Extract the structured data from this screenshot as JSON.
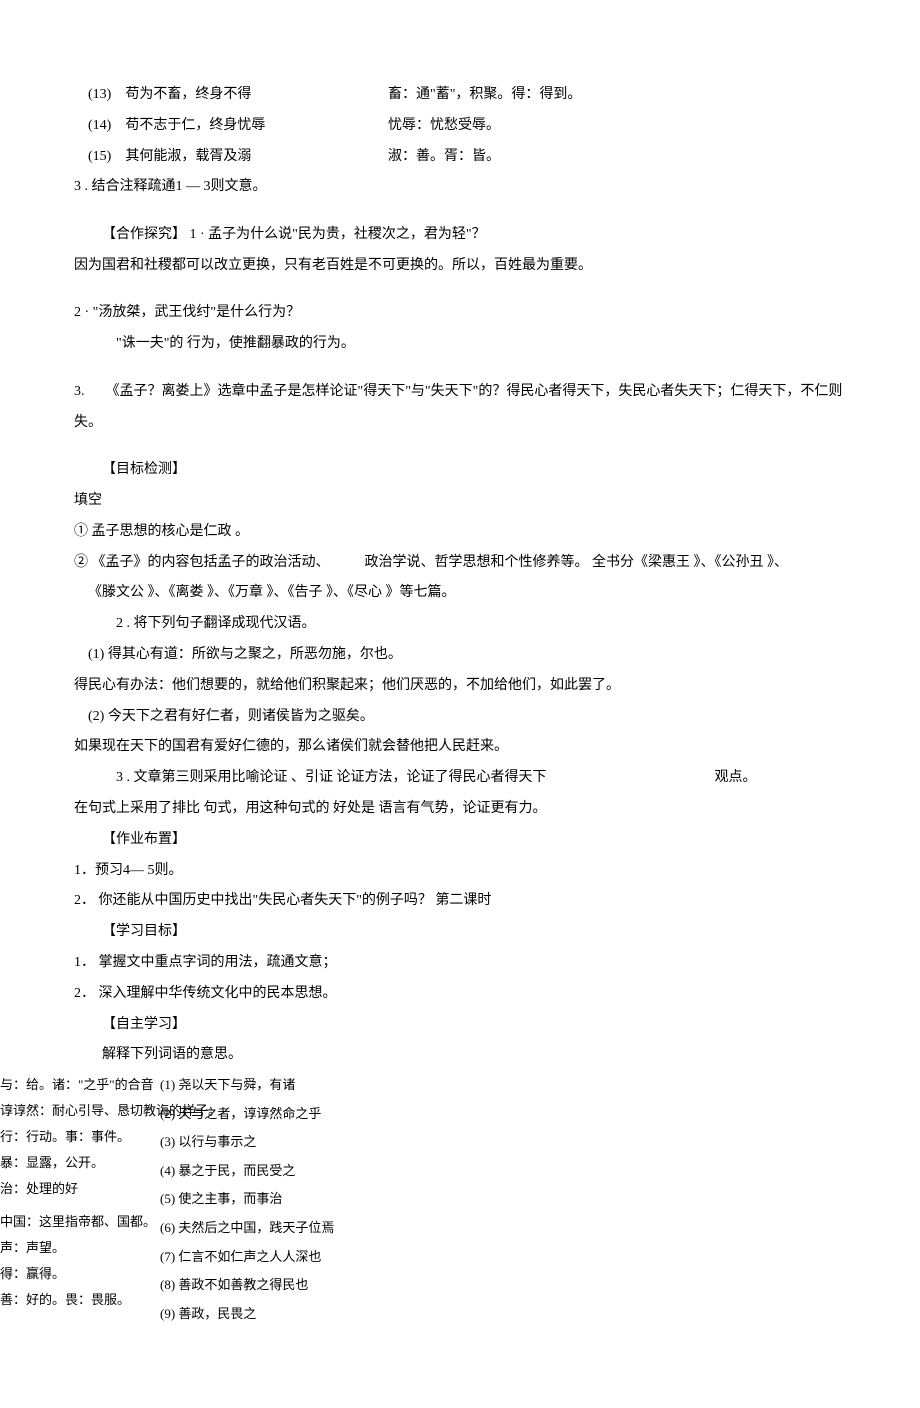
{
  "items": [
    {
      "num": "(13)",
      "text": "苟为不畜，终身不得",
      "note": "畜：通\"蓄\"，积聚。得：得到。"
    },
    {
      "num": "(14)",
      "text": "苟不志于仁，终身忧辱",
      "note": "忧辱：忧愁受辱。"
    },
    {
      "num": "(15)",
      "text": "其何能淑，载胥及溺",
      "note": "淑：善。胥：皆。"
    }
  ],
  "line3": "3 . 结合注释疏通1 — 3则文意。",
  "coop_title": "【合作探究】 1 · 孟子为什么说\"民为贵，社稷次之，君为轻\"？",
  "coop_ans1": "因为国君和社稷都可以改立更换，只有老百姓是不可更换的。所以，百姓最为重要。",
  "q2": "2 · \"汤放桀，武王伐纣\"是什么行为？",
  "q2_ans": "\"诛一夫\"的 行为，使推翻暴政的行为。",
  "q3_pre": "3.",
  "q3": "《孟子？离娄上》选章中孟子是怎样论证\"得天下\"与\"失天下\"的？得民心者得天下，失民心者失天下；仁得天下，不仁则失。",
  "goal_check": "【目标检测】",
  "fill": "填空",
  "f1": "① 孟子思想的核心是仁政 。",
  "f2a": "② 《孟子》的内容包括孟子的政治活动、",
  "f2b": "政治学说、哲学思想和个性修养等。 全书分《梁惠王 》、《公孙丑 》、",
  "f2c": "《滕文公 》、《离娄 》、《万章 》、《告子 》、《尽心 》等七篇。",
  "trans_title": "2 . 将下列句子翻译成现代汉语。",
  "t1": "(1) 得其心有道：所欲与之聚之，所恶勿施，尔也。",
  "t1a": "得民心有办法：他们想要的，就给他们积聚起来；他们厌恶的，不加给他们，如此罢了。",
  "t2": "(2) 今天下之君有好仁者，则诸侯皆为之驱矣。",
  "t2a": "如果现在天下的国君有爱好仁德的，那么诸侯们就会替他把人民赶来。",
  "t3": "3 . 文章第三则采用比喻论证 、引证 论证方法，论证了得民心者得天下",
  "t3_end": "观点。",
  "t3b": "在句式上采用了排比 句式，用这种句式的 好处是 语言有气势，论证更有力。",
  "hw": "【作业布置】",
  "hw1": "1．预习4— 5则。",
  "hw2": "2． 你还能从中国历史中找出\"失民心者失天下\"的例子吗？ 第二课时",
  "goal2": "【学习目标】",
  "g1": "1． 掌握文中重点字词的用法，疏通文意；",
  "g2": "2． 深入理解中华传统文化中的民本思想。",
  "self": "【自主学习】",
  "self_t": "解释下列词语的意思。",
  "overlap": {
    "left": [
      "与：给。诸：\"之乎\"的合音",
      "谆谆然：耐心引导、恳切教诲的样子。",
      "行：行动。事：事件。",
      "暴：显露，公开。",
      "治：处理的好",
      "中国：这里指帝都、国都。",
      "声：声望。",
      "得：赢得。",
      "善：好的。畏：畏服。"
    ],
    "right": [
      "(1) 尧以天下与舜，有诸",
      "(2) 天与之者，谆谆然命之乎",
      "(3) 以行与事示之",
      "(4) 暴之于民，而民受之",
      "(5) 使之主事，而事治",
      "(6) 夫然后之中国，践天子位焉",
      "(7) 仁言不如仁声之人人深也",
      "(8) 善政不如善教之得民也",
      "(9) 善政，民畏之"
    ]
  }
}
